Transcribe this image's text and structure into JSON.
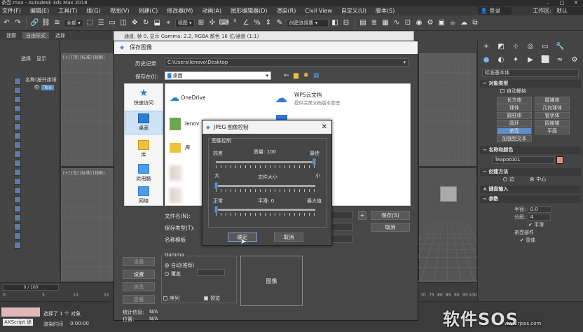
{
  "window": {
    "title": "茶壶.max - Autodesk 3ds Max 2018"
  },
  "menubar": {
    "items": [
      "文件(F)",
      "编辑(E)",
      "工具(T)",
      "组(G)",
      "视图(V)",
      "创建(C)",
      "修改器(M)",
      "动画(A)",
      "图形编辑器(D)",
      "渲染(R)",
      "Civil View",
      "自定义(U)",
      "脚本(S)"
    ],
    "user": "登录",
    "workspace": "工作区:",
    "workspace_value": "默认"
  },
  "toolbar": {
    "filter": "全部",
    "view": "视图",
    "selection_set": "创建选择集"
  },
  "ribbon": {
    "tabs": [
      "建模",
      "自由形式",
      "选择"
    ]
  },
  "explorer": {
    "tabs": [
      "选择",
      "显示"
    ],
    "rows": [
      "名称(按升序排",
      "Tea"
    ]
  },
  "viewports": {
    "top_left": "[+] [顶] [标准] [线框]",
    "bottom_left": "[+] [左] [标准] [线框]"
  },
  "bitmap_window": {
    "title": "通道, 帧 0, 显示 Gamma: 2.2, RGBA 颜色 16 位/通道 (1:1)"
  },
  "save_dialog": {
    "title": "保存图像",
    "history_label": "历史记录",
    "history_value": "C:\\Users\\lenovo\\Desktop",
    "save_in_label": "保存在(I):",
    "save_in_value": "桌面",
    "places": [
      "快速访问",
      "桌面",
      "库",
      "此电脑",
      "网络"
    ],
    "files": [
      {
        "name": "OneDrive",
        "sub": ""
      },
      {
        "name": "WPS云文档",
        "sub": "提供完美文档版本管理"
      },
      {
        "name": "lenov",
        "sub": ""
      },
      {
        "name": "库",
        "sub": ""
      }
    ],
    "filename_label": "文件名(N):",
    "filetype_label": "保存类型(T):",
    "device_label": "名称模板",
    "save_button": "保存(S)",
    "cancel_button": "取消",
    "buttons_left": [
      "设备",
      "设置",
      "信息",
      "查看"
    ],
    "gamma": {
      "title": "Gamma",
      "auto": "自动(推荐)",
      "override": "覆盖"
    },
    "sequence": "序列",
    "preview_check": "预览",
    "preview_box": "图像",
    "stats_label": "统计信息:",
    "stats_value": "N/A",
    "location_label": "位置:",
    "location_value": "N/A"
  },
  "jpeg_dialog": {
    "title": "JPEG 图像控制",
    "group_title": "图像控制",
    "quality_low": "较差",
    "quality_label": "质量:",
    "quality_value": "100",
    "quality_high": "最佳",
    "quality_level": 1.0,
    "size_large": "大",
    "size_label": "文件大小",
    "size_small": "小",
    "size_level": 0.0,
    "smooth_normal": "正常",
    "smooth_label": "平滑:",
    "smooth_value": "0",
    "smooth_max": "最大值",
    "smooth_level": 0.0,
    "ok_button": "确定",
    "cancel_button": "取消"
  },
  "command_panel": {
    "category": "标准基本体",
    "object_type_title": "对象类型",
    "autogrid": "自动栅格",
    "objects": [
      "长方体",
      "圆锥体",
      "球体",
      "几何球体",
      "圆柱体",
      "管状体",
      "圆环",
      "四棱锥",
      "茶壶",
      "平面",
      "加强型文本"
    ],
    "selected_object": "茶壶",
    "name_color_title": "名称和颜色",
    "object_name": "Teapot001",
    "object_color": "#e88a8a",
    "creation_method_title": "创建方法",
    "creation_edge": "边",
    "creation_center": "中心",
    "keyboard_entry_title": "键盘输入",
    "params_title": "参数",
    "radius_label": "半径:",
    "radius_value": "0.0",
    "segments_label": "分段:",
    "segments_value": "4",
    "smooth_label": "平滑",
    "teapot_parts": "茶壶部件",
    "body": "壶体"
  },
  "timeline": {
    "frame": "0 / 100",
    "ticks": [
      "0",
      "5",
      "10",
      "15",
      "70",
      "75",
      "80",
      "85",
      "90",
      "95",
      "100"
    ]
  },
  "statusbar": {
    "selection": "选择了 1 个 对象",
    "script": "AXScript 迷",
    "render_time_label": "渲染时间",
    "render_time_value": "0:00:00"
  },
  "watermark": {
    "brand": "软件SOS",
    "url": "www.rjsos.com"
  }
}
